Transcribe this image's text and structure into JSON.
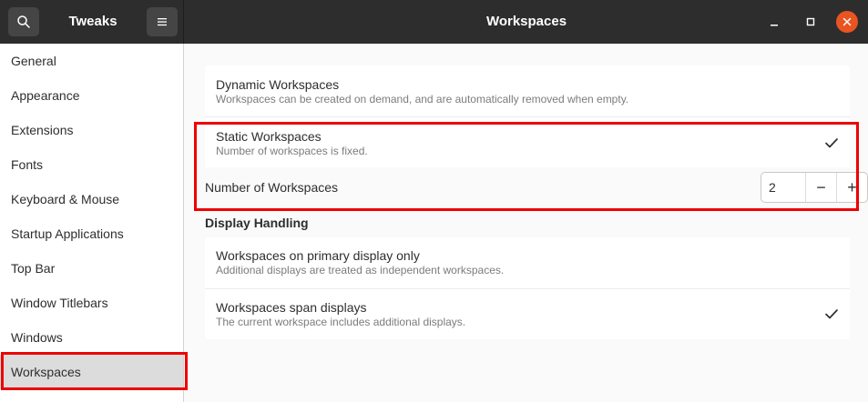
{
  "header": {
    "app_title": "Tweaks",
    "page_title": "Workspaces",
    "search_icon": "search-icon",
    "menu_icon": "hamburger-menu-icon",
    "window_buttons": [
      "minimize-icon",
      "maximize-icon",
      "close-icon"
    ],
    "accent_color": "#e95420"
  },
  "sidebar": {
    "items": [
      {
        "label": "General"
      },
      {
        "label": "Appearance"
      },
      {
        "label": "Extensions"
      },
      {
        "label": "Fonts"
      },
      {
        "label": "Keyboard & Mouse"
      },
      {
        "label": "Startup Applications"
      },
      {
        "label": "Top Bar"
      },
      {
        "label": "Window Titlebars"
      },
      {
        "label": "Windows"
      },
      {
        "label": "Workspaces",
        "selected": true
      }
    ]
  },
  "main": {
    "dynamic": {
      "title": "Dynamic Workspaces",
      "subtitle": "Workspaces can be created on demand, and are automatically removed when empty.",
      "checked": false
    },
    "static": {
      "title": "Static Workspaces",
      "subtitle": "Number of workspaces is fixed.",
      "checked": true
    },
    "number": {
      "label": "Number of Workspaces",
      "value": "2",
      "decrement": "−",
      "increment": "+"
    },
    "display_handling": {
      "heading": "Display Handling",
      "primary_only": {
        "title": "Workspaces on primary display only",
        "subtitle": "Additional displays are treated as independent workspaces.",
        "checked": false
      },
      "span": {
        "title": "Workspaces span displays",
        "subtitle": "The current workspace includes additional displays.",
        "checked": true
      }
    }
  },
  "highlight_color": "#ee0000"
}
